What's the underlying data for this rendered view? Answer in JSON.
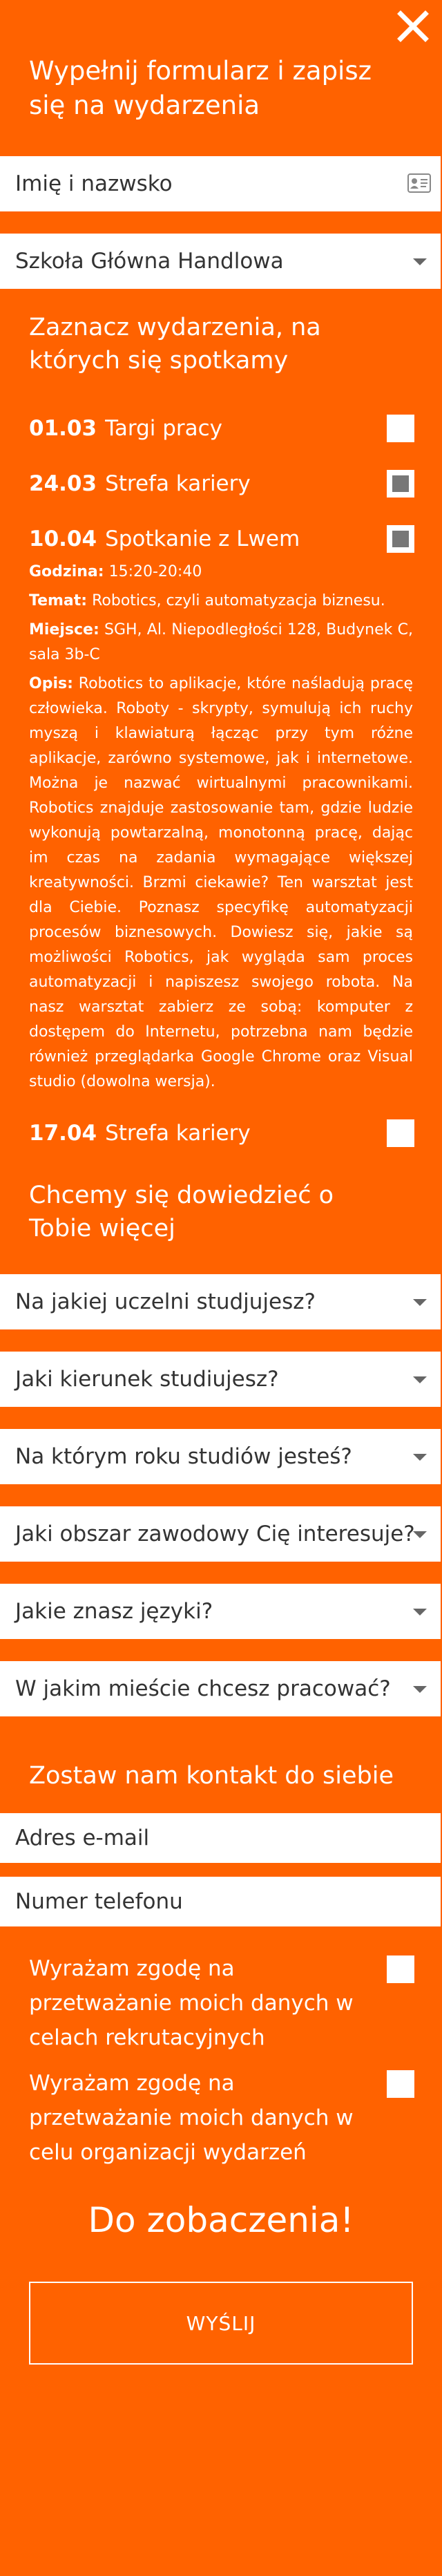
{
  "header": {
    "title": "Wypełnij formularz i zapisz się na wydarzenia",
    "close_icon": "close-icon"
  },
  "fields": {
    "name_placeholder": "Imię i nazwsko",
    "school_value": "Szkoła Główna Handlowa"
  },
  "events_section": {
    "title": "Zaznacz wydarzenia, na których się spotkamy",
    "events": [
      {
        "date": "01.03",
        "name": "Targi pracy",
        "checked": false
      },
      {
        "date": "24.03",
        "name": "Strefa kariery",
        "checked": true
      },
      {
        "date": "10.04",
        "name": "Spotkanie z Lwem",
        "checked": true
      },
      {
        "date": "17.04",
        "name": "Strefa kariery",
        "checked": false
      }
    ],
    "details": {
      "time_label": "Godzina:",
      "time_value": "15:20-20:40",
      "topic_label": "Temat:",
      "topic_value": "Robotics, czyli automatyzacja biznesu.",
      "place_label": "Miejsce:",
      "place_value": "SGH, Al. Niepodległości 128, Budynek C, sala 3b-C",
      "desc_label": "Opis:",
      "desc_value": "Robotics to aplikacje, które naśladują pracę człowieka. Roboty - skrypty, symulują ich ruchy myszą i klawiaturą łącząc przy tym różne aplikacje, zarówno systemowe, jak i internetowe. Można je nazwać wirtualnymi pracownikami. Robotics znajduje zastosowanie tam, gdzie ludzie wykonują powtarzalną, monotonną pracę, dając im czas na zadania wymagające większej kreatywności. Brzmi ciekawie? Ten warsztat jest dla Ciebie. Poznasz specyfikę automatyzacji procesów biznesowych. Dowiesz się, jakie są możliwości Robotics, jak wygląda sam proces automatyzacji i napiszesz swojego robota. Na nasz warsztat zabierz ze sobą: komputer z dostępem do Internetu, potrzebna nam będzie również przeglądarka Google Chrome oraz Visual studio (dowolna wersja)."
    }
  },
  "about_section": {
    "title": "Chcemy się dowiedzieć o Tobie więcej",
    "selects": [
      "Na jakiej uczelni studjujesz?",
      "Jaki kierunek studiujesz?",
      "Na którym roku studiów jesteś?",
      "Jaki obszar zawodowy Cię interesuje?",
      "Jakie znasz języki?",
      "W jakim mieście chcesz pracować?"
    ]
  },
  "contact_section": {
    "title": "Zostaw nam kontakt do siebie",
    "email_placeholder": "Adres e-mail",
    "phone_placeholder": "Numer telefonu",
    "consents": [
      {
        "text": "Wyrażam zgodę na przetważanie moich danych w celach rekrutacyjnych",
        "checked": false
      },
      {
        "text": "Wyrażam zgodę na przetważanie moich danych w celu organizacji wydarzeń",
        "checked": false
      }
    ]
  },
  "footer": {
    "farewell": "Do zobaczenia!",
    "submit_label": "WYŚLIJ"
  },
  "colors": {
    "background": "#FF6200",
    "field_background": "#FFFFFF",
    "text": "#FFFFFF",
    "checkbox_mark": "#777777"
  }
}
